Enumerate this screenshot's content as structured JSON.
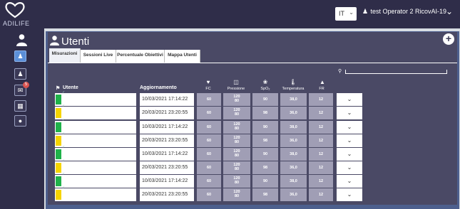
{
  "app": {
    "logo_text": "ADILIFE"
  },
  "topbar": {
    "language": "IT",
    "user_name": "test Operator 2 RicovAI-19"
  },
  "sidebar": {
    "items": [
      {
        "name": "patients",
        "icon": "person-icon",
        "active": true
      },
      {
        "name": "groups",
        "icon": "group-icon",
        "active": false
      },
      {
        "name": "messages",
        "icon": "mail-icon",
        "active": false,
        "badge": "5"
      },
      {
        "name": "reports",
        "icon": "table-icon",
        "active": false
      },
      {
        "name": "video",
        "icon": "video-icon",
        "active": false
      }
    ]
  },
  "page": {
    "title": "Utenti"
  },
  "tabs": [
    "Misurazioni",
    "Sessioni Live",
    "Percentuale Obiettivi",
    "Mappa Utenti"
  ],
  "table": {
    "headers": {
      "utente": "Utente",
      "aggiornamento": "Aggiornamento",
      "fc": "FC",
      "pressione": "Pressione",
      "spo2": "SpO₂",
      "temperatura": "Temperatura",
      "fr": "FR"
    },
    "rows": [
      {
        "status_color": "#1fb24a",
        "date": "10/03/2021 17:14:22",
        "fc": "60",
        "press_sys": "120",
        "press_dia": "80",
        "spo2": "90",
        "temp": "38,0",
        "fr": "12"
      },
      {
        "status_color": "#f5d400",
        "date": "20/03/2021 23:20:55",
        "fc": "60",
        "press_sys": "120",
        "press_dia": "80",
        "spo2": "98",
        "temp": "36,0",
        "fr": "12"
      },
      {
        "status_color": "#1fb24a",
        "date": "10/03/2021 17:14:22",
        "fc": "60",
        "press_sys": "120",
        "press_dia": "80",
        "spo2": "90",
        "temp": "38,0",
        "fr": "12"
      },
      {
        "status_color": "#f5d400",
        "date": "20/03/2021 23:20:55",
        "fc": "60",
        "press_sys": "120",
        "press_dia": "80",
        "spo2": "98",
        "temp": "36,0",
        "fr": "12"
      },
      {
        "status_color": "#1fb24a",
        "date": "10/03/2021 17:14:22",
        "fc": "60",
        "press_sys": "120",
        "press_dia": "80",
        "spo2": "90",
        "temp": "38,0",
        "fr": "12"
      },
      {
        "status_color": "#f5d400",
        "date": "20/03/2021 23:20:55",
        "fc": "60",
        "press_sys": "120",
        "press_dia": "80",
        "spo2": "98",
        "temp": "36,0",
        "fr": "12"
      },
      {
        "status_color": "#1fb24a",
        "date": "10/03/2021 17:14:22",
        "fc": "60",
        "press_sys": "120",
        "press_dia": "80",
        "spo2": "90",
        "temp": "38,0",
        "fr": "12"
      },
      {
        "status_color": "#f5d400",
        "date": "20/03/2021 23:20:55",
        "fc": "60",
        "press_sys": "120",
        "press_dia": "80",
        "spo2": "98",
        "temp": "36,0",
        "fr": "12"
      }
    ]
  }
}
